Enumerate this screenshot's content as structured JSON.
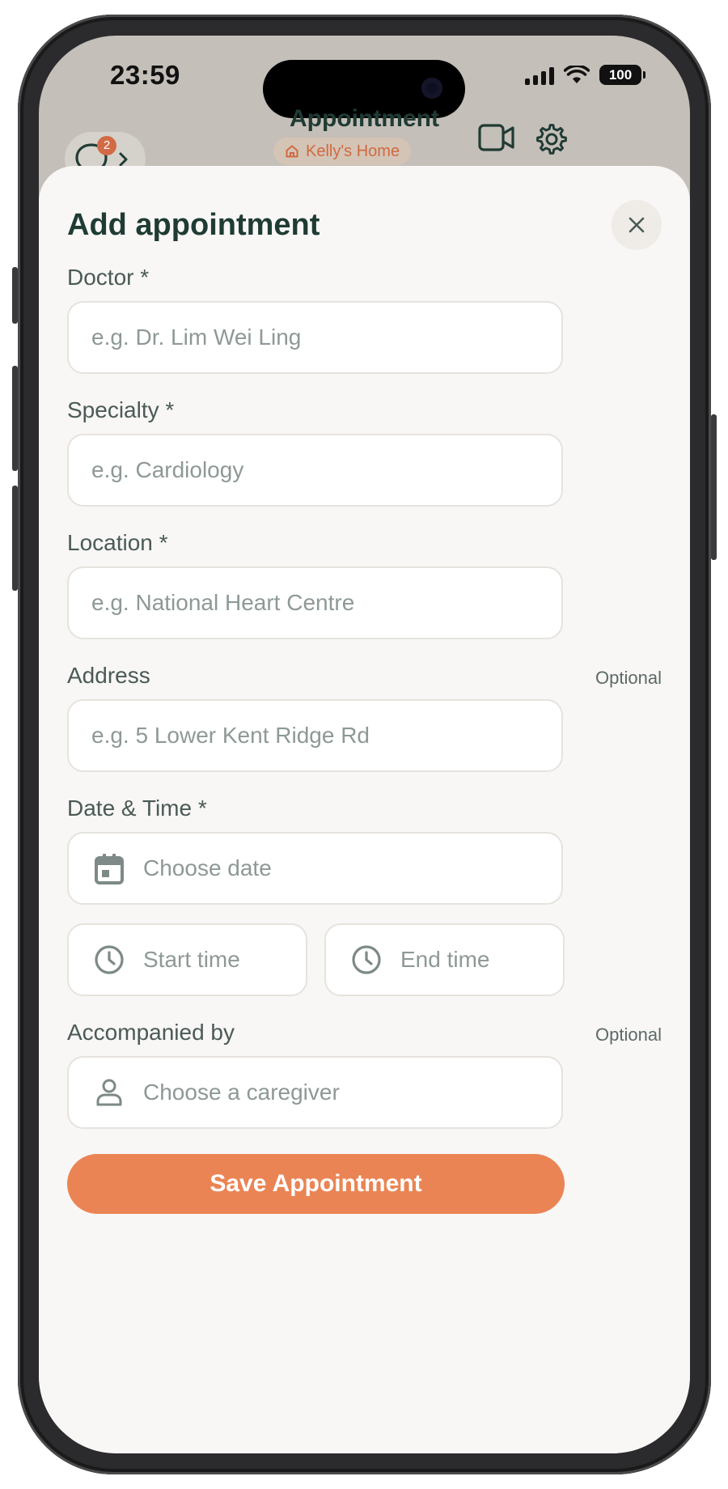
{
  "status_bar": {
    "time": "23:59",
    "battery": "100"
  },
  "header": {
    "title": "Appointment",
    "home_chip": "Kelly's Home",
    "notification_count": "2"
  },
  "sheet": {
    "title": "Add appointment",
    "fields": {
      "doctor": {
        "label": "Doctor *",
        "placeholder": "e.g. Dr. Lim Wei Ling"
      },
      "specialty": {
        "label": "Specialty *",
        "placeholder": "e.g. Cardiology"
      },
      "location": {
        "label": "Location *",
        "placeholder": "e.g. National Heart Centre"
      },
      "address": {
        "label": "Address",
        "optional": "Optional",
        "placeholder": "e.g. 5 Lower Kent Ridge Rd"
      },
      "datetime": {
        "label": "Date & Time *",
        "date_placeholder": "Choose date",
        "start_placeholder": "Start time",
        "end_placeholder": "End time"
      },
      "accompanied": {
        "label": "Accompanied by",
        "optional": "Optional",
        "placeholder": "Choose a caregiver"
      }
    },
    "save_label": "Save Appointment"
  },
  "colors": {
    "accent": "#ea8454",
    "title": "#1f3b34",
    "placeholder": "#8e9996",
    "header_bg": "#c4bfb8",
    "sheet_bg": "#f8f7f5"
  },
  "icons": [
    "chat-bubble-icon",
    "chevron-right-icon",
    "house-icon",
    "video-camera-icon",
    "gear-icon",
    "close-icon",
    "calendar-icon",
    "clock-icon",
    "person-icon"
  ]
}
